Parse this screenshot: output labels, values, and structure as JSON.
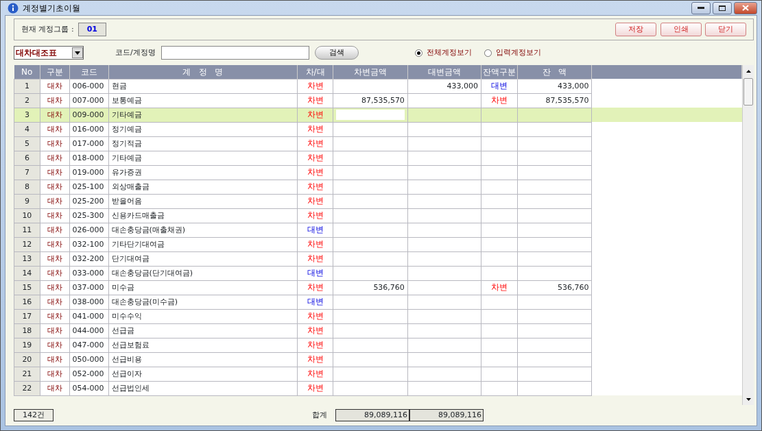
{
  "window": {
    "title": "계정별기초이월"
  },
  "group": {
    "label": "현재 계정그룹 :",
    "value": "01"
  },
  "buttons": [
    "저장",
    "인쇄",
    "닫기"
  ],
  "filter": {
    "statement": "대차대조표",
    "search_label": "코드/계정명",
    "search_button": "검색",
    "views": [
      {
        "label": "전체계정보기",
        "selected": true
      },
      {
        "label": "입력계정보기",
        "selected": false
      }
    ]
  },
  "table": {
    "columns": [
      "No",
      "구분",
      "코드",
      "계   정   명",
      "차/대",
      "차변금액",
      "대변금액",
      "잔액구분",
      "잔   액"
    ],
    "rows": [
      {
        "no": "1",
        "group": "대차",
        "code": "006-000",
        "name": "현금",
        "side": {
          "text": "차변",
          "kind": "debit"
        },
        "credit": "433,000",
        "balance_side": {
          "text": "대변",
          "kind": "credit"
        },
        "balance": "433,000",
        "selected": false
      },
      {
        "no": "2",
        "group": "대차",
        "code": "007-000",
        "name": "보통예금",
        "side": {
          "text": "차변",
          "kind": "debit"
        },
        "debit": "87,535,570",
        "balance_side": {
          "text": "차변",
          "kind": "debit"
        },
        "balance": "87,535,570",
        "selected": false
      },
      {
        "no": "3",
        "group": "대차",
        "code": "009-000",
        "name": "기타예금",
        "side": {
          "text": "차변",
          "kind": "debit"
        },
        "selected": true
      },
      {
        "no": "4",
        "group": "대차",
        "code": "016-000",
        "name": "정기예금",
        "side": {
          "text": "차변",
          "kind": "debit"
        },
        "selected": false
      },
      {
        "no": "5",
        "group": "대차",
        "code": "017-000",
        "name": "정기적금",
        "side": {
          "text": "차변",
          "kind": "debit"
        },
        "selected": false
      },
      {
        "no": "6",
        "group": "대차",
        "code": "018-000",
        "name": "기타예금",
        "side": {
          "text": "차변",
          "kind": "debit"
        },
        "selected": false
      },
      {
        "no": "7",
        "group": "대차",
        "code": "019-000",
        "name": "유가증권",
        "side": {
          "text": "차변",
          "kind": "debit"
        },
        "selected": false
      },
      {
        "no": "8",
        "group": "대차",
        "code": "025-100",
        "name": "외상매출금",
        "side": {
          "text": "차변",
          "kind": "debit"
        },
        "selected": false
      },
      {
        "no": "9",
        "group": "대차",
        "code": "025-200",
        "name": "받을어음",
        "side": {
          "text": "차변",
          "kind": "debit"
        },
        "selected": false
      },
      {
        "no": "10",
        "group": "대차",
        "code": "025-300",
        "name": "신용카드매출금",
        "side": {
          "text": "차변",
          "kind": "debit"
        },
        "selected": false
      },
      {
        "no": "11",
        "group": "대차",
        "code": "026-000",
        "name": "대손충당금(매출채권)",
        "side": {
          "text": "대변",
          "kind": "credit"
        },
        "selected": false
      },
      {
        "no": "12",
        "group": "대차",
        "code": "032-100",
        "name": "기타단기대여금",
        "side": {
          "text": "차변",
          "kind": "debit"
        },
        "selected": false
      },
      {
        "no": "13",
        "group": "대차",
        "code": "032-200",
        "name": "단기대여금",
        "side": {
          "text": "차변",
          "kind": "debit"
        },
        "selected": false
      },
      {
        "no": "14",
        "group": "대차",
        "code": "033-000",
        "name": "대손충당금(단기대여금)",
        "side": {
          "text": "대변",
          "kind": "credit"
        },
        "selected": false
      },
      {
        "no": "15",
        "group": "대차",
        "code": "037-000",
        "name": "미수금",
        "side": {
          "text": "차변",
          "kind": "debit"
        },
        "debit": "536,760",
        "balance_side": {
          "text": "차변",
          "kind": "debit"
        },
        "balance": "536,760",
        "selected": false
      },
      {
        "no": "16",
        "group": "대차",
        "code": "038-000",
        "name": "대손충당금(미수금)",
        "side": {
          "text": "대변",
          "kind": "credit"
        },
        "selected": false
      },
      {
        "no": "17",
        "group": "대차",
        "code": "041-000",
        "name": "미수수익",
        "side": {
          "text": "차변",
          "kind": "debit"
        },
        "selected": false
      },
      {
        "no": "18",
        "group": "대차",
        "code": "044-000",
        "name": "선급금",
        "side": {
          "text": "차변",
          "kind": "debit"
        },
        "selected": false
      },
      {
        "no": "19",
        "group": "대차",
        "code": "047-000",
        "name": "선급보험료",
        "side": {
          "text": "차변",
          "kind": "debit"
        },
        "selected": false
      },
      {
        "no": "20",
        "group": "대차",
        "code": "050-000",
        "name": "선급비용",
        "side": {
          "text": "차변",
          "kind": "debit"
        },
        "selected": false
      },
      {
        "no": "21",
        "group": "대차",
        "code": "052-000",
        "name": "선급이자",
        "side": {
          "text": "차변",
          "kind": "debit"
        },
        "selected": false
      },
      {
        "no": "22",
        "group": "대차",
        "code": "054-000",
        "name": "선급법인세",
        "side": {
          "text": "차변",
          "kind": "debit"
        },
        "selected": false
      }
    ]
  },
  "footer": {
    "count": "142건",
    "total_label": "합계",
    "total_debit": "89,089,116",
    "total_credit": "89,089,116"
  }
}
